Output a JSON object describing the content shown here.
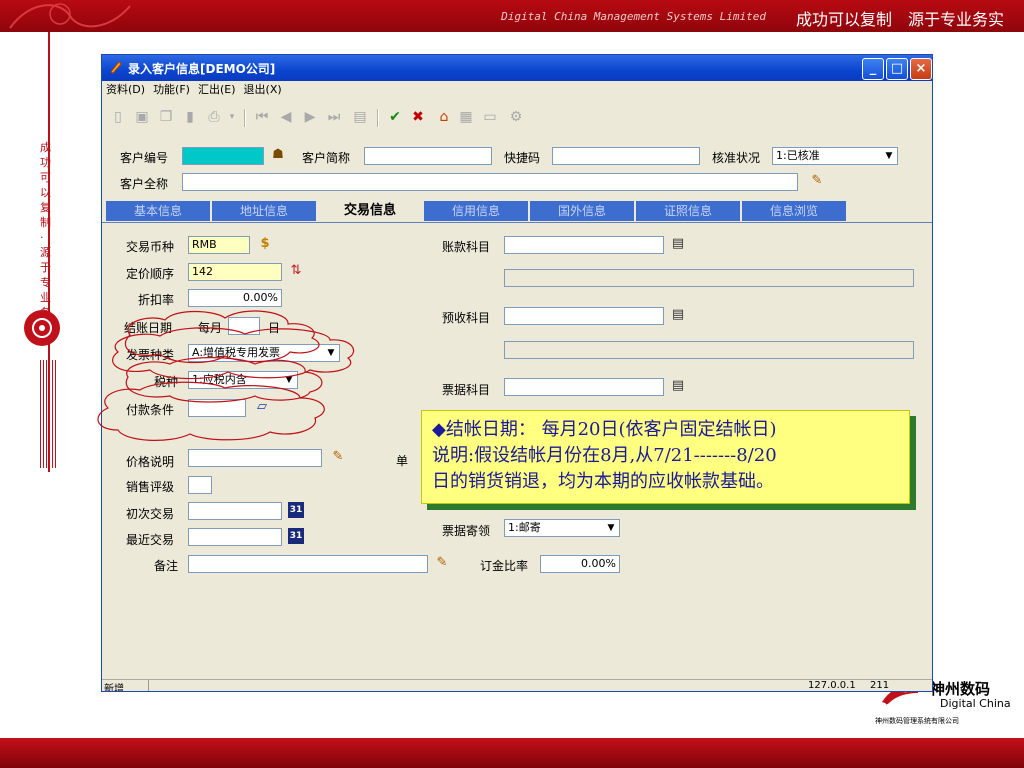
{
  "slide": {
    "header_en": "Digital China Management Systems Limited",
    "header_cn": "成功可以复制　源于专业务实",
    "vertical_text": "成功可以复制·源于专业务实",
    "logo_cn": "神州数码",
    "logo_en": "Digital China",
    "logo_sub": "神州数码管理系统有限公司"
  },
  "window": {
    "title": "录入客户信息[DEMO公司]",
    "menu": [
      "资料(D)",
      "功能(F)",
      "汇出(E)",
      "退出(X)"
    ],
    "controls": {
      "minimize": "_",
      "maximize": "□",
      "close": "×"
    }
  },
  "header_form": {
    "customer_no_label": "客户编号",
    "customer_no_value": "",
    "short_name_label": "客户简称",
    "short_name_value": "",
    "quick_code_label": "快捷码",
    "quick_code_value": "",
    "approval_label": "核准状况",
    "approval_value": "1:已核准",
    "full_name_label": "客户全称",
    "full_name_value": ""
  },
  "tabs": [
    {
      "label": "基本信息"
    },
    {
      "label": "地址信息"
    },
    {
      "label": "交易信息"
    },
    {
      "label": "信用信息"
    },
    {
      "label": "国外信息"
    },
    {
      "label": "证照信息"
    },
    {
      "label": "信息浏览"
    }
  ],
  "trade": {
    "currency_label": "交易币种",
    "currency_value": "RMB",
    "price_order_label": "定价顺序",
    "price_order_value": "142",
    "discount_label": "折扣率",
    "discount_value": "0.00%",
    "closing_label": "结账日期",
    "closing_prefix": "每月",
    "closing_value": "",
    "closing_suffix": "日",
    "invoice_type_label": "发票种类",
    "invoice_type_value": "A:增值税专用发票",
    "tax_label": "税种",
    "tax_value": "1:应税内含",
    "payment_label": "付款条件",
    "payment_value": "",
    "price_note_label": "价格说明",
    "price_note_value": "",
    "sales_rating_label": "销售评级",
    "sales_rating_value": "",
    "first_trade_label": "初次交易",
    "first_trade_value": "",
    "last_trade_label": "最近交易",
    "last_trade_value": "",
    "remarks_label": "备注",
    "remarks_value": "",
    "ar_account_label": "账款科目",
    "ar_account_value": "",
    "prepaid_label": "预收科目",
    "prepaid_value": "",
    "note_account_label": "票据科目",
    "note_account_value": "",
    "note_delivery_label": "票据寄领",
    "note_delivery_value": "1:邮寄",
    "deposit_label": "订金比率",
    "deposit_value": "0.00%",
    "hidden_char": "单"
  },
  "callout": {
    "line1": "◆结帐日期：  每月20日(依客户固定结帐日)",
    "line2": "说明:假设结帐月份在8月,从7/21-------8/20",
    "line3": "日的销货销退，均为本期的应收帐款基础。"
  },
  "status": {
    "mode": "新增",
    "ip": "127.0.0.1",
    "code": "211"
  },
  "colors": {
    "brand_red": "#b80a12",
    "title_blue": "#0a45cf",
    "tab_blue": "#3e6dd0",
    "note_yellow": "#ffff80"
  }
}
